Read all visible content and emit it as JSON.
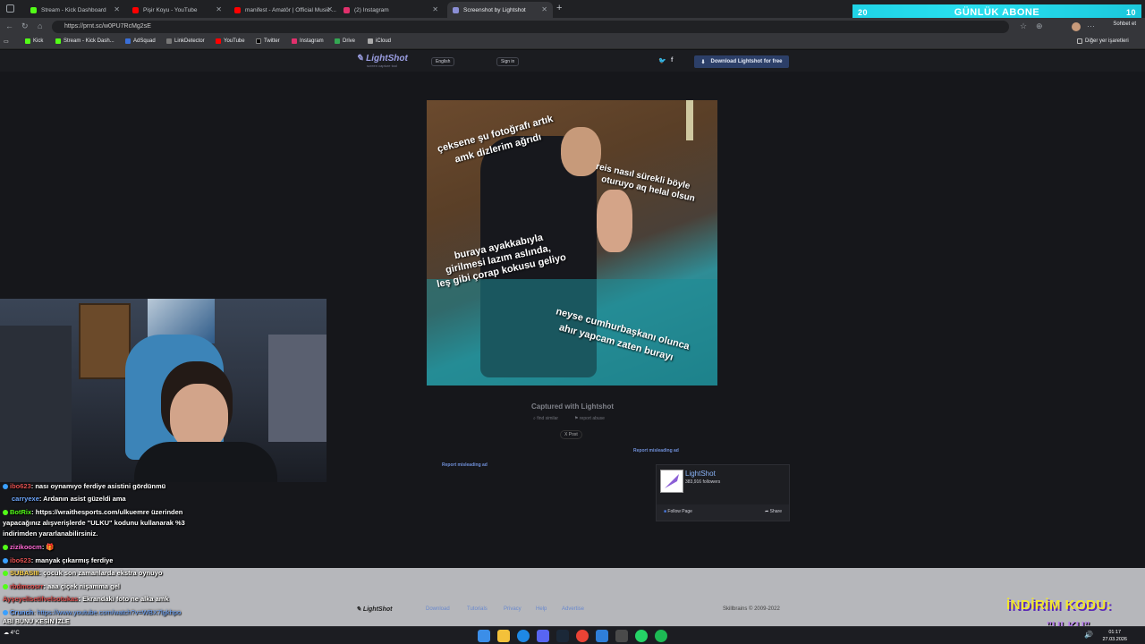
{
  "tabs": [
    {
      "label": "Stream - Kick Dashboard",
      "color": "#53fc18"
    },
    {
      "label": "Pişir Koyu - YouTube",
      "color": "#ff0000"
    },
    {
      "label": "manifest - Amatör | Official Music ...",
      "color": "#ff0000"
    },
    {
      "label": "(2) Instagram",
      "color": "#e1306c"
    },
    {
      "label": "Screenshot by Lightshot",
      "color": "#8b8fd6"
    }
  ],
  "sub_banner": {
    "left": "20",
    "text": "GÜNLÜK ABONE",
    "right": "10"
  },
  "address": {
    "url": "https://prnt.sc/w0PU7RcMg2sE"
  },
  "chat_button": "Sohbet et",
  "bookmarks": [
    {
      "label": "Kick"
    },
    {
      "label": "Stream - Kick Dash..."
    },
    {
      "label": "AdSquad"
    },
    {
      "label": "LinkDetector"
    },
    {
      "label": "YouTube"
    },
    {
      "label": "Twitter"
    },
    {
      "label": "Instagram"
    },
    {
      "label": "Drive"
    },
    {
      "label": "iCloud"
    }
  ],
  "other_bookmarks": "Diğer yer işaretleri",
  "lightshot": {
    "logo": "LightShot",
    "logo_sub": "screen capture tool",
    "language": "English",
    "sign_in": "Sign in",
    "download": "Download Lightshot for free",
    "captured": "Captured with Lightshot",
    "find_similar": "find similar",
    "report_abuse": "report abuse",
    "post": "Post",
    "report_ad_1": "Report misleading ad",
    "report_ad_2": "Report misleading ad",
    "fb_name": "LightShot",
    "fb_followers": "383,916 followers",
    "fb_follow": "Follow Page",
    "fb_share": "Share",
    "footer_logo": "LightShot",
    "footer_links": [
      "Download",
      "Tutorials",
      "Privacy",
      "Help",
      "Advertise"
    ],
    "footer_copy": "Skillbrains © 2009-2022"
  },
  "image_captions": {
    "c1": "çeksene şu fotoğrafı artık",
    "c2": "amk dizlerim ağrıdı",
    "c3": "reis nasıl sürekli böyle",
    "c4": "oturuyo aq helal olsun",
    "c5": "buraya ayakkabıyla",
    "c6": "girilmesi lazım aslında,",
    "c7": "leş gibi çorap kokusu geliyo",
    "c8": "neyse cumhurbaşkanı olunca",
    "c9": "ahır yapcam zaten burayı"
  },
  "chat": [
    {
      "user": "ibo623",
      "user_color": "#e05050",
      "text": ": nası oynamıyo ferdiye asistini gördünmü"
    },
    {
      "user": "carryexe",
      "user_color": "#6fa8ff",
      "text": ": Ardanın asist güzeldi ama"
    },
    {
      "user": "BotRix",
      "user_color": "#53fc18",
      "text": ": https://wraithesports.com/ulkuemre üzerinden"
    },
    {
      "user": "",
      "user_color": "#ffffff",
      "text": "yapacağınız alışverişlerde \"ULKU\" kodunu kullanarak %3"
    },
    {
      "user": "",
      "user_color": "#ffffff",
      "text": "indirimden yararlanabilirsiniz."
    },
    {
      "user": "zizikoocm",
      "user_color": "#ff6ad5",
      "text": ":"
    },
    {
      "user": "ibo623",
      "user_color": "#e05050",
      "text": ": manyak çıkarmış ferdiye"
    },
    {
      "user": "SUBASIII",
      "user_color": "#ffd54f",
      "text": ": çocuk son zamanlarda ekstra oynuyo"
    },
    {
      "user": "rbdmcosrr",
      "user_color": "#e05050",
      "text": ": aaa çiçek nişamma gel"
    },
    {
      "user": "Ayşeyelisetifvelsotukas",
      "user_color": "#e05050",
      "text": ": Ekrandaki foto ne alka amk"
    },
    {
      "user": "Crunch",
      "user_color": "#6fa8ff",
      "text": ": https://www.youtube.com/watch?v=WBX7lgkhpo"
    }
  ],
  "ticker": "ABİ BUNU KESİN İZLE",
  "weather": "4°C",
  "promo": {
    "line1": "İNDİRİM KODU:",
    "line2": "\"ULKU\""
  },
  "clock": {
    "time": "01:17",
    "date": "27.03.2026"
  }
}
